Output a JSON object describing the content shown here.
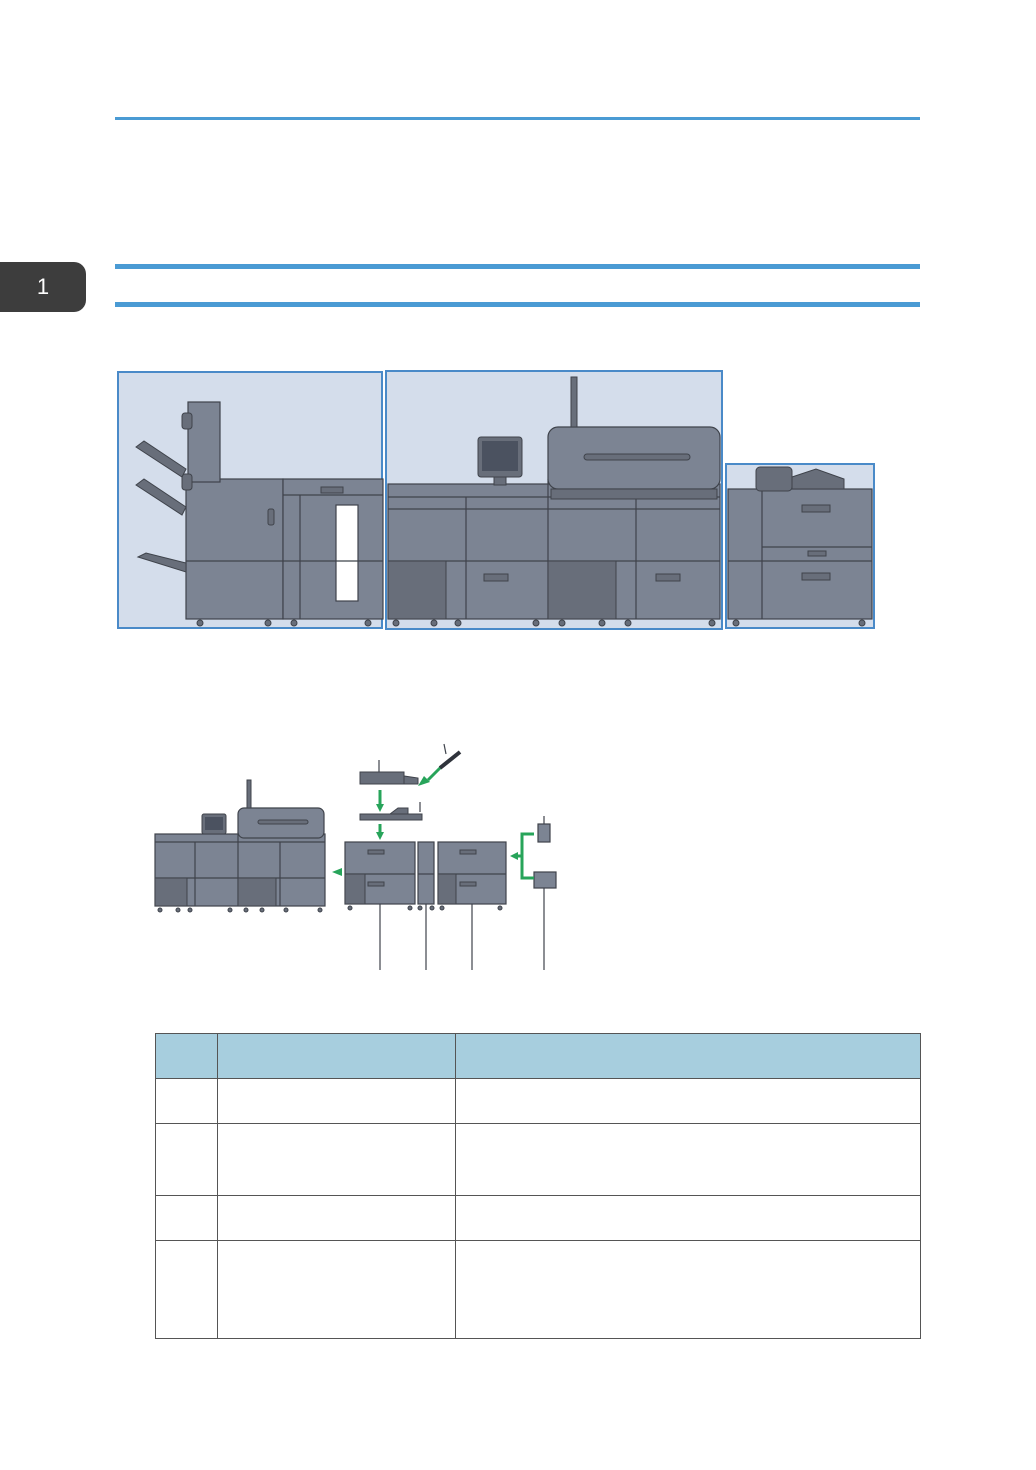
{
  "colors": {
    "rule": "#4a9bd4",
    "chapter_tab": "#3d3d3d",
    "panel_fill": "#d4ddeb",
    "panel_border": "#4a8ac8",
    "machine_body": "#7c8493",
    "machine_dark": "#686e7a",
    "machine_outline": "#3f434b",
    "arrow": "#27a45a",
    "table_header": "#a7cede"
  },
  "chapter": {
    "number": "1"
  },
  "figure_main": {
    "panels": [
      "finisher-section",
      "main-unit-section",
      "paper-feed-section"
    ]
  },
  "figure_options": {
    "icons": [
      "printer-main-unit",
      "feed-tray-option",
      "bridge-unit-option",
      "large-capacity-tray-option",
      "small-option-units"
    ]
  },
  "table": {
    "headers": [
      "",
      "",
      ""
    ],
    "rows": [
      [
        "",
        "",
        ""
      ],
      [
        "",
        "",
        ""
      ],
      [
        "",
        "",
        ""
      ],
      [
        "",
        "",
        ""
      ]
    ],
    "row_heights": [
      45,
      72,
      45,
      98
    ]
  }
}
